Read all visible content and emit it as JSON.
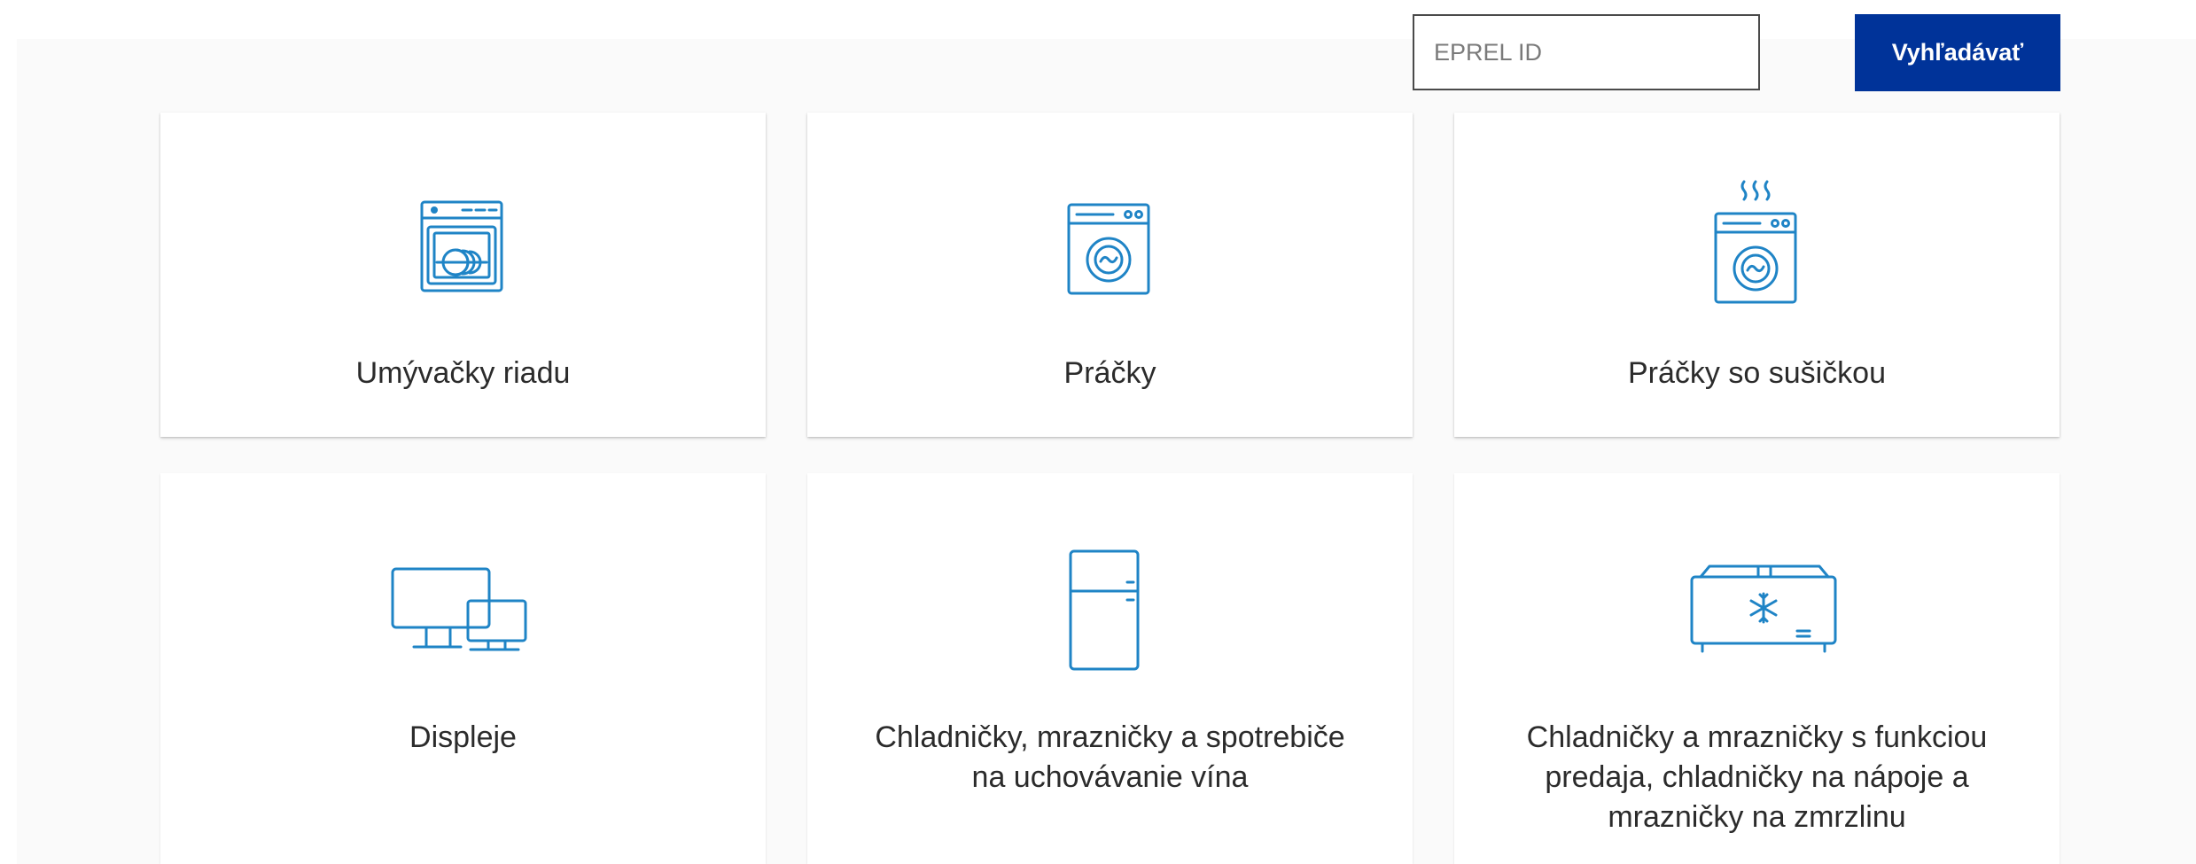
{
  "search": {
    "placeholder": "EPREL ID",
    "value": "",
    "button_label": "Vyhľadávať"
  },
  "colors": {
    "accent": "#003399",
    "icon": "#1f84c6",
    "text": "#2b2b2b"
  },
  "categories": [
    {
      "icon": "dishwasher-icon",
      "label": "Umývačky riadu"
    },
    {
      "icon": "washing-machine-icon",
      "label": "Práčky"
    },
    {
      "icon": "washer-dryer-icon",
      "label": "Práčky so sušičkou"
    },
    {
      "icon": "displays-icon",
      "label": "Displeje"
    },
    {
      "icon": "refrigerator-icon",
      "label_lines": [
        "Chladničky, mrazničky a spotrebiče",
        "na uchovávanie vína"
      ]
    },
    {
      "icon": "chest-freezer-icon",
      "label_lines": [
        "Chladničky a mrazničky s funkciou",
        "predaja, chladničky na nápoje a",
        "mrazničky na zmrzlinu"
      ]
    }
  ]
}
